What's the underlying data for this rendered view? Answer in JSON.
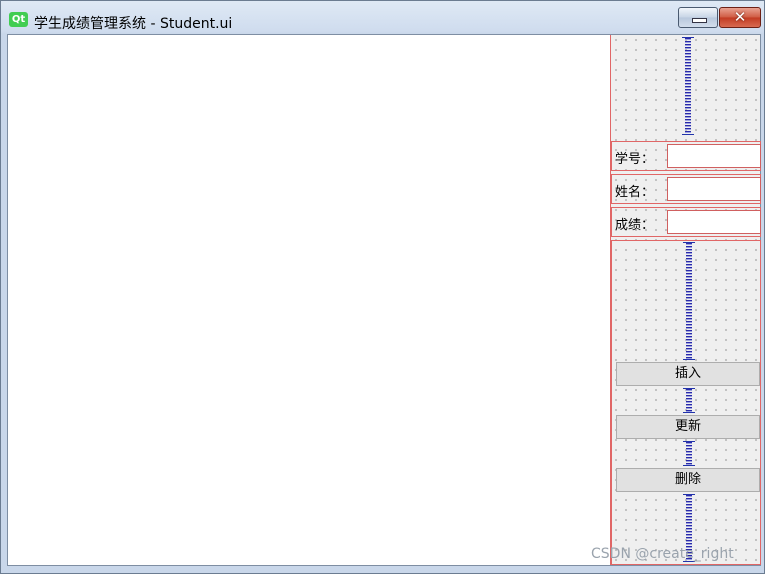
{
  "window": {
    "title": "学生成绩管理系统 - Student.ui",
    "app_icon": "Qt",
    "controls": {
      "minimize": "minimize-icon",
      "close": "✕"
    }
  },
  "form": {
    "fields": [
      {
        "label": "学号：",
        "value": ""
      },
      {
        "label": "姓名：",
        "value": ""
      },
      {
        "label": "成绩：",
        "value": ""
      }
    ],
    "buttons": {
      "insert": "插入",
      "update": "更新",
      "delete": "删除"
    }
  },
  "colors": {
    "layout_border": "#e06666",
    "spacer": "#2a2aa8",
    "qt_green": "#41cd52"
  },
  "watermark": "CSDN @create_right"
}
